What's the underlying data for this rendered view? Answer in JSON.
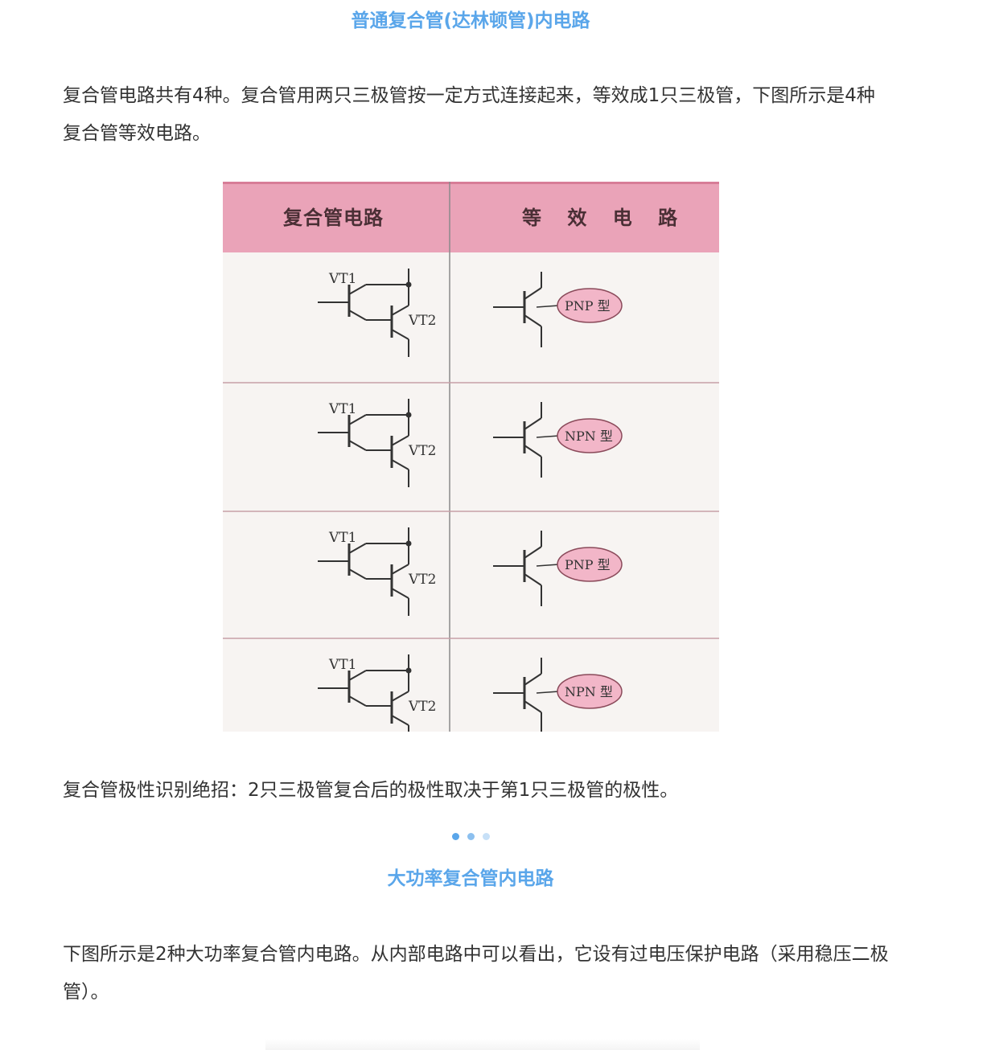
{
  "section1": {
    "title": "普通复合管(达林顿管)内电路",
    "paragraph": "复合管电路共有4种。复合管用两只三极管按一定方式连接起来，等效成1只三极管，下图所示是4种复合管等效电路。"
  },
  "figure": {
    "header_left": "复合管电路",
    "header_right": "等 效 电 路",
    "rows": [
      {
        "vt1": "VT1",
        "vt2": "VT2",
        "type": "PNP 型"
      },
      {
        "vt1": "VT1",
        "vt2": "VT2",
        "type": "NPN 型"
      },
      {
        "vt1": "VT1",
        "vt2": "VT2",
        "type": "PNP 型"
      },
      {
        "vt1": "VT1",
        "vt2": "VT2",
        "type": "NPN 型"
      }
    ]
  },
  "section1_note": "复合管极性识别绝招：2只三极管复合后的极性取决于第1只三极管的极性。",
  "section2": {
    "title": "大功率复合管内电路",
    "paragraph": "下图所示是2种大功率复合管内电路。从内部电路中可以看出，它设有过电压保护电路（采用稳压二极管）。"
  },
  "colors": {
    "accent": "#5aa6ea",
    "header_pink": "#eaa3b8",
    "ellipse_pink": "#f2b6c8"
  }
}
